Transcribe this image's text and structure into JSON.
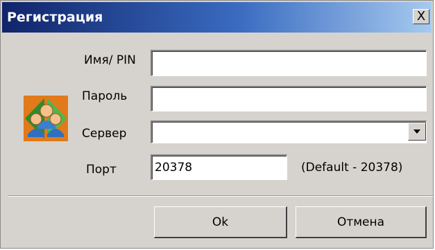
{
  "window": {
    "title": "Регистрация",
    "close_label": "X"
  },
  "icon": "users-login-icon",
  "form": {
    "name_label": "Имя/ PIN",
    "name_value": "",
    "password_label": "Пароль",
    "password_value": "",
    "server_label": "Сервер",
    "server_value": "",
    "port_label": "Порт",
    "port_value": "20378",
    "port_hint": "(Default - 20378)"
  },
  "buttons": {
    "ok": "Ok",
    "cancel": "Отмена"
  },
  "colors": {
    "title_start": "#10246a",
    "title_end": "#a6caf0",
    "face": "#d6d3ce"
  }
}
